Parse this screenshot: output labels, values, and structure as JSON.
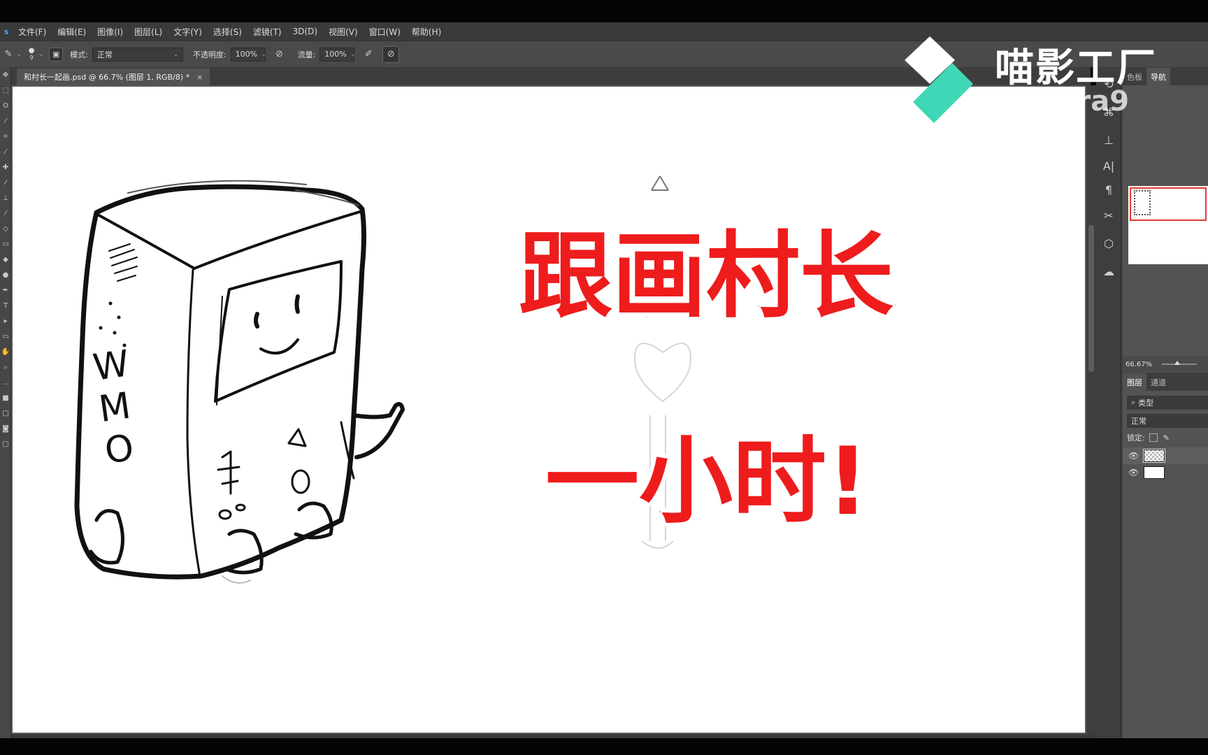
{
  "app": {
    "menu": [
      "文件(F)",
      "编辑(E)",
      "图像(I)",
      "图层(L)",
      "文字(Y)",
      "选择(S)",
      "滤镜(T)",
      "3D(D)",
      "视图(V)",
      "窗口(W)",
      "帮助(H)"
    ]
  },
  "options": {
    "brush_size": "9",
    "mode_label": "模式:",
    "mode_value": "正常",
    "opacity_label": "不透明度:",
    "opacity_value": "100%",
    "flow_label": "流量:",
    "flow_value": "100%"
  },
  "document": {
    "tab_title": "和村长一起画.psd @ 66.7% (图层 1, RGB/8) *",
    "close": "×"
  },
  "overlay": {
    "line1": "跟画村长",
    "line2": "一小时!"
  },
  "watermark": {
    "brand": "喵影工厂",
    "sub": "filmora9"
  },
  "right_panel": {
    "tabs": [
      "色板",
      "导航"
    ],
    "zoom": "66.67%",
    "layer_tabs": [
      "图层",
      "通道"
    ],
    "filter_label": "类型",
    "blend_mode": "正常",
    "lock_label": "锁定:"
  },
  "drawing_text": {
    "side_letters": "WMO"
  }
}
